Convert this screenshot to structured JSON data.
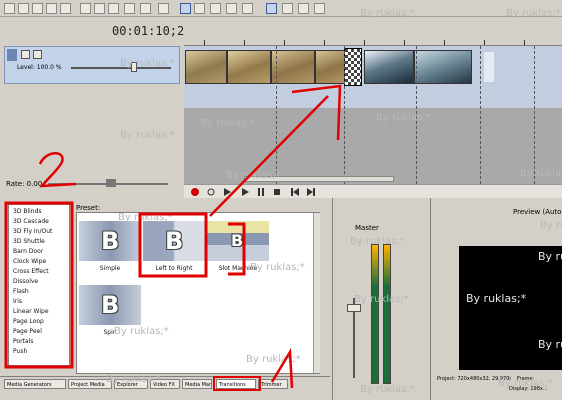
{
  "header": {
    "timecode": "00:01:10;27"
  },
  "track": {
    "level_label": "Level: 100.0 %"
  },
  "timeline": {
    "rate_label": "Rate: 0.00"
  },
  "transitions": {
    "preset_header": "Preset:",
    "list_items": [
      "3D Blinds",
      "3D Cascade",
      "3D Fly In/Out",
      "3D Shuttle",
      "Barn Door",
      "Clock Wipe",
      "Cross Effect",
      "Dissolve",
      "Flash",
      "Iris",
      "Linear Wipe",
      "Page Loop",
      "Page Peel",
      "Portals",
      "Push"
    ],
    "presets": [
      {
        "label": "Simple"
      },
      {
        "label": "Left to Right"
      },
      {
        "label": "Slot Machine"
      },
      {
        "label": "Spin"
      }
    ]
  },
  "tabs": [
    {
      "label": "Media Generators"
    },
    {
      "label": "Project Media"
    },
    {
      "label": "Explorer"
    },
    {
      "label": "Video FX"
    },
    {
      "label": "Media Manager"
    },
    {
      "label": "Transitions"
    },
    {
      "label": "Trimmer"
    }
  ],
  "mixer": {
    "master_label": "Master"
  },
  "preview": {
    "mode_label": "Preview (Auto)",
    "project_line": "Project: 720x480x32, 29.970i",
    "frame_label": "Frame:",
    "display_line": "Display: 198x..."
  },
  "watermark": {
    "text": "By ruklas;*"
  },
  "colors": {
    "annotation_red": "#e00000",
    "timeline_bg": "#a9a9a9",
    "track_header": "#c3d3ea"
  }
}
